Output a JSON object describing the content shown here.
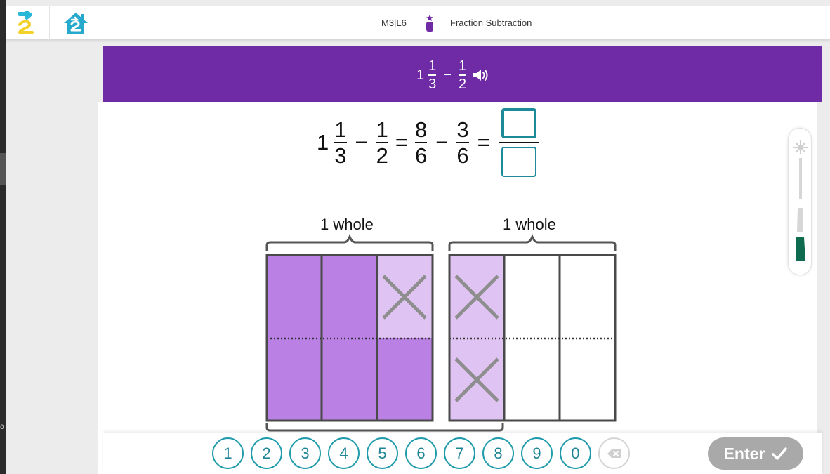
{
  "header": {
    "lesson_code": "M3|L6",
    "lesson_title": "Fraction Subtraction"
  },
  "prompt": {
    "whole": "1",
    "frac1": {
      "num": "1",
      "den": "3"
    },
    "operator": "−",
    "frac2": {
      "num": "1",
      "den": "2"
    }
  },
  "equation": {
    "whole": "1",
    "f1": {
      "num": "1",
      "den": "3"
    },
    "op1": "−",
    "f2": {
      "num": "1",
      "den": "2"
    },
    "eq1": "=",
    "f3": {
      "num": "8",
      "den": "6"
    },
    "op2": "−",
    "f4": {
      "num": "3",
      "den": "6"
    },
    "eq2": "=",
    "answer_numerator": "",
    "answer_denominator": ""
  },
  "model": {
    "label_left": "1 whole",
    "label_right": "1 whole"
  },
  "keypad": {
    "keys": [
      "1",
      "2",
      "3",
      "4",
      "5",
      "6",
      "7",
      "8",
      "9",
      "0"
    ],
    "enter_label": "Enter"
  },
  "colors": {
    "band": "#6f2aa5",
    "shaded": "#bb80e4",
    "crossed": "#dfc3f2",
    "accent": "#1f9bab",
    "progress": "#0e6b4f"
  },
  "icons": [
    "next-arrow-icon",
    "home-icon",
    "lesson-marker-icon",
    "speaker-icon",
    "star-icon",
    "checkmark-icon",
    "backspace-icon",
    "cross-out-mark-icon"
  ]
}
